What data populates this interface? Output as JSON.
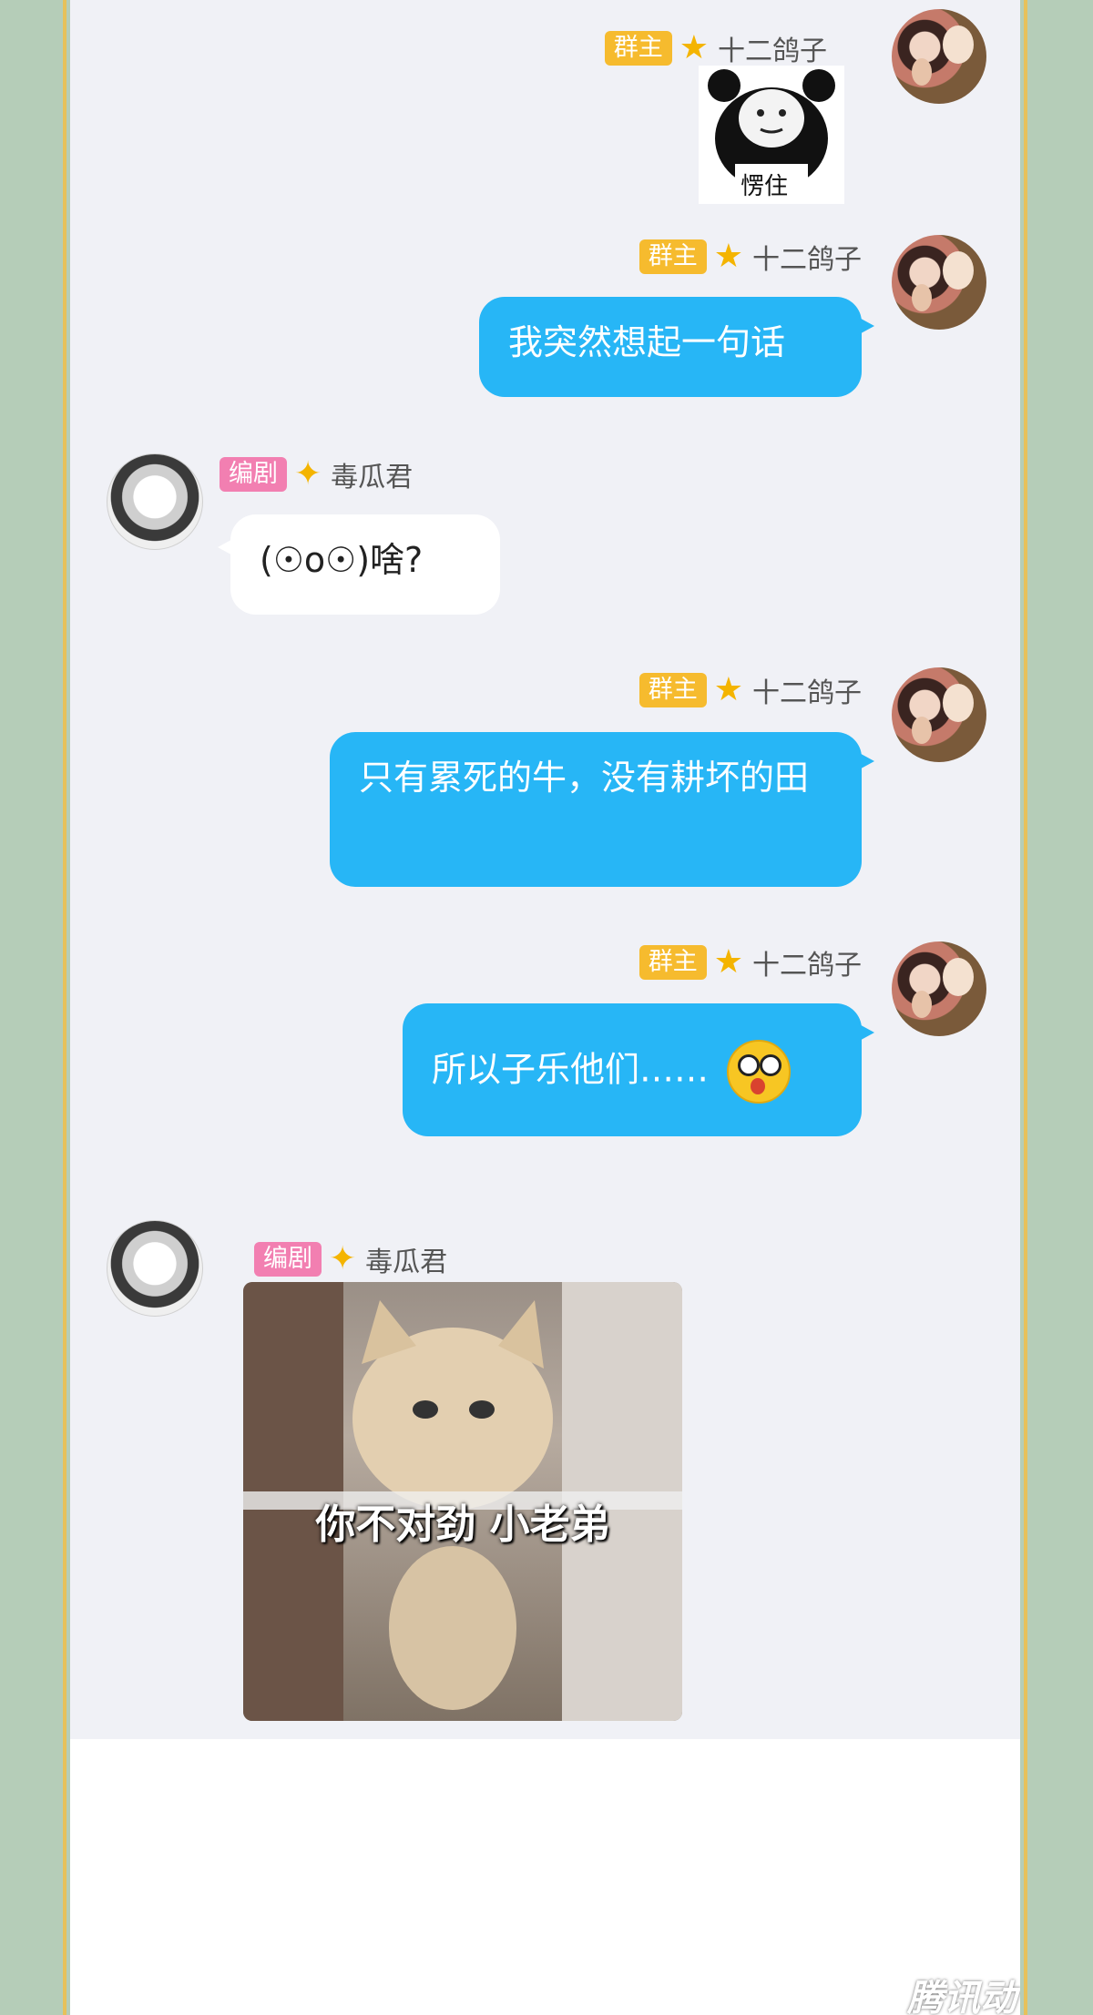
{
  "messages": [
    {
      "sender": "十二鸽子",
      "role": "群主",
      "type": "sticker",
      "sticker_text": "愣住"
    },
    {
      "sender": "十二鸽子",
      "role": "群主",
      "type": "text",
      "text": "我突然想起一句话"
    },
    {
      "sender": "毒瓜君",
      "role": "编剧",
      "type": "text",
      "text": "(☉o☉)啥?"
    },
    {
      "sender": "十二鸽子",
      "role": "群主",
      "type": "text",
      "text": "只有累死的牛，没有耕坏的田"
    },
    {
      "sender": "十二鸽子",
      "role": "群主",
      "type": "text",
      "text": "所以子乐他们……"
    },
    {
      "sender": "毒瓜君",
      "role": "编剧",
      "type": "image",
      "image_caption": "你不对劲 小老弟"
    }
  ],
  "watermark": "腾讯动漫",
  "colors": {
    "accent_blue": "#27b6f6",
    "owner_badge": "#f6bb2e",
    "editor_badge": "#f27fb1",
    "frame": "#e7c15b",
    "background": "#b5cdb8"
  }
}
